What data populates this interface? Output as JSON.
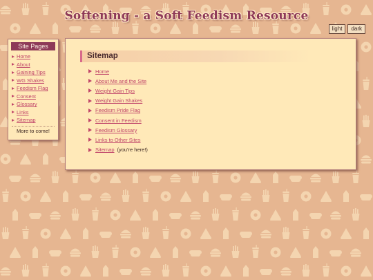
{
  "header": {
    "title": "Softening - a Soft Feedism Resource"
  },
  "theme_switcher": {
    "light_label": "light",
    "dark_label": "dark"
  },
  "sidebar": {
    "heading": "Site Pages",
    "items": [
      {
        "label": "Home"
      },
      {
        "label": "About"
      },
      {
        "label": "Gaining Tips"
      },
      {
        "label": "WG Shakes"
      },
      {
        "label": "Feedism Flag"
      },
      {
        "label": "Consent"
      },
      {
        "label": "Glossary"
      },
      {
        "label": "Links"
      },
      {
        "label": "Sitemap"
      }
    ],
    "note": "More to come!"
  },
  "main": {
    "heading": "Sitemap",
    "items": [
      {
        "label": "Home",
        "note": ""
      },
      {
        "label": "About Me and the Site",
        "note": ""
      },
      {
        "label": "Weight Gain Tips",
        "note": ""
      },
      {
        "label": "Weight Gain Shakes",
        "note": ""
      },
      {
        "label": "Feedism Pride Flag",
        "note": ""
      },
      {
        "label": "Consent in Feedism",
        "note": ""
      },
      {
        "label": "Feedism Glossary",
        "note": ""
      },
      {
        "label": "Links to Other Sites",
        "note": ""
      },
      {
        "label": "Sitemap",
        "note": "(you're here!)"
      }
    ]
  },
  "colors": {
    "background": "#e6b691",
    "panel": "#ffe9b8",
    "accent": "#8e3a58",
    "link": "#c0456a",
    "pattern": "#f4d5b0"
  }
}
